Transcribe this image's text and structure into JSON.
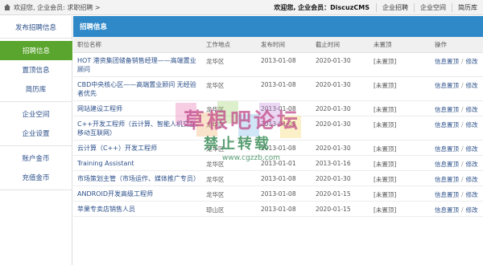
{
  "breadcrumb": {
    "text": "欢迎您, 企业会员:",
    "link": "求职招聘",
    "arrow": ">"
  },
  "topnav": {
    "welcome": "欢迎您, 企业会员：DiscuzCMS",
    "links": [
      "企业招聘",
      "企业空间",
      "简历库"
    ]
  },
  "sidebar": {
    "top": "发布招聘信息",
    "group1": [
      "招聘信息",
      "置顶信息",
      "简历库"
    ],
    "group2": [
      "企业空间",
      "企业设置"
    ],
    "group3": [
      "账户金币",
      "充值金币"
    ]
  },
  "panel": {
    "title": "招聘信息"
  },
  "table": {
    "headers": [
      "职位名称",
      "工作地点",
      "发布时间",
      "截止时间",
      "未置顶",
      "操作"
    ],
    "rows": [
      {
        "title": "HOT 港资集团储备销售经理——高端置业顾问",
        "location": "龙华区",
        "published": "2013-01-08",
        "deadline": "2020-01-30",
        "status": "[未置顶]"
      },
      {
        "title": "CBD中央核心区——高端置业顾问 无经验者优先",
        "location": "龙华区",
        "published": "2013-01-08",
        "deadline": "2020-01-30",
        "status": "[未置顶]"
      },
      {
        "title": "网站建设工程师",
        "location": "龙华区",
        "published": "2013-01-08",
        "deadline": "2020-01-30",
        "status": "[未置顶]"
      },
      {
        "title": "C++开发工程师（云计算、智能人机交互、移动互联网）",
        "location": "龙华区",
        "published": "2013-01-08",
        "deadline": "2020-01-30",
        "status": "[未置顶]"
      },
      {
        "title": "云计算（C++）开发工程师",
        "location": "龙华区",
        "published": "2013-01-08",
        "deadline": "2020-01-30",
        "status": "[未置顶]"
      },
      {
        "title": "Training Assistant",
        "location": "龙华区",
        "published": "2013-01-01",
        "deadline": "2013-01-16",
        "status": "[未置顶]"
      },
      {
        "title": "市场策划主管（市场运作、媒体推广专员）",
        "location": "龙华区",
        "published": "2013-01-08",
        "deadline": "2020-01-30",
        "status": "[未置顶]"
      },
      {
        "title": "ANDROID开发高级工程师",
        "location": "龙华区",
        "published": "2013-01-08",
        "deadline": "2020-01-15",
        "status": "[未置顶]"
      },
      {
        "title": "苹果专卖店销售人员",
        "location": "琼山区",
        "published": "2013-01-08",
        "deadline": "2020-01-15",
        "status": "[未置顶]"
      }
    ],
    "op_pin": "信息置顶",
    "op_edit": "修改"
  },
  "watermark": {
    "line1": "草根吧论坛",
    "line2": "禁止转载",
    "url": "www.cgzzb.com"
  },
  "colors": {
    "header_blue": "#2f89c9",
    "active_green": "#5aa52d",
    "link_blue": "#2b4f8a"
  }
}
